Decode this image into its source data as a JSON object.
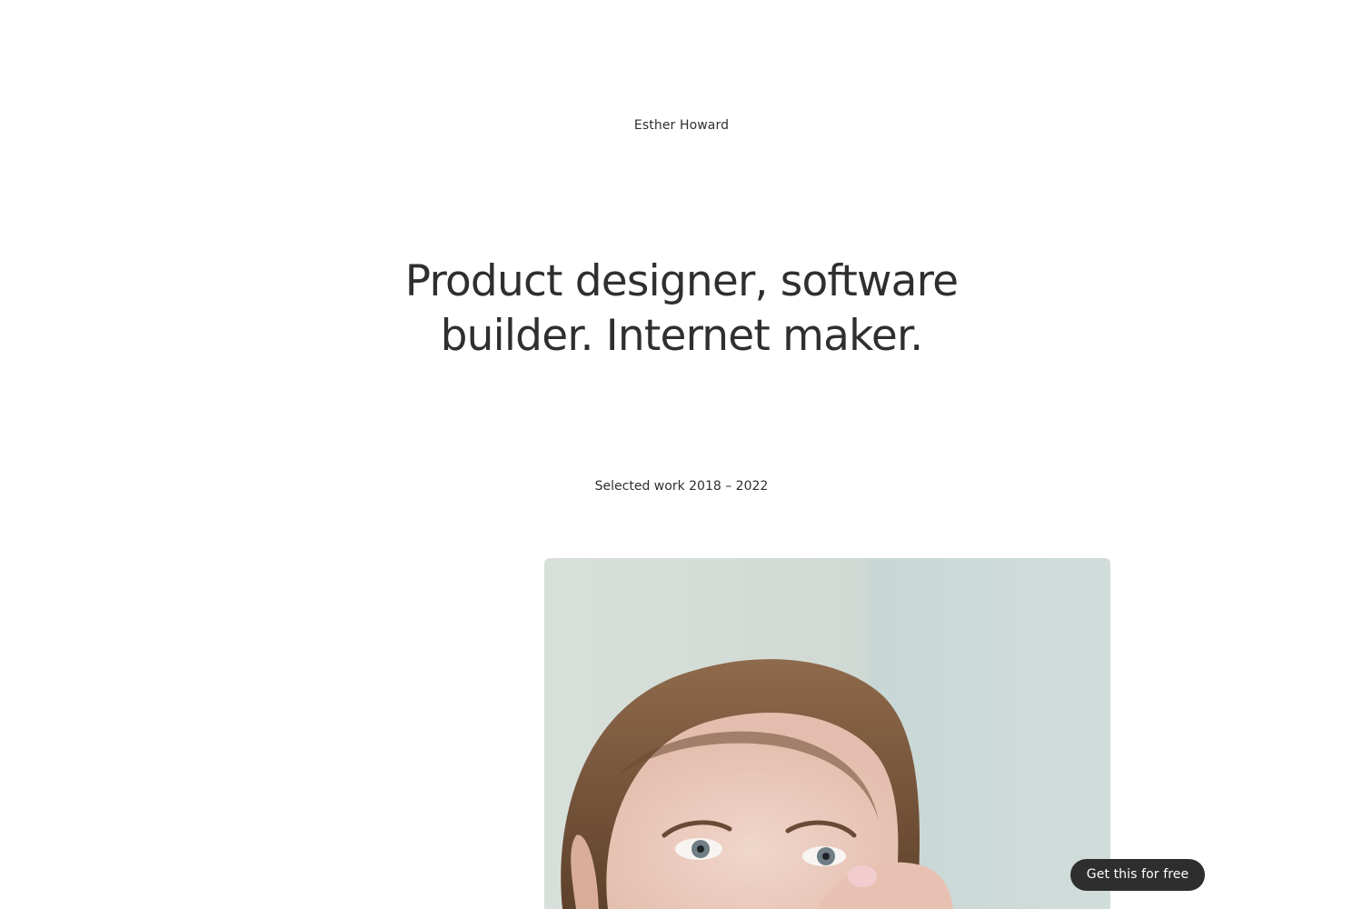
{
  "header": {
    "name": "Esther Howard"
  },
  "hero": {
    "line1": "Product designer, software",
    "line2": "builder. Internet maker."
  },
  "work": {
    "label": "Selected work 2018 – 2022",
    "image_icon": "photo-icon"
  },
  "cta": {
    "label": "Get this for free"
  },
  "colors": {
    "text": "#2f2f2f",
    "button_bg": "#2e2e2e",
    "button_text": "#ffffff",
    "background": "#ffffff"
  }
}
